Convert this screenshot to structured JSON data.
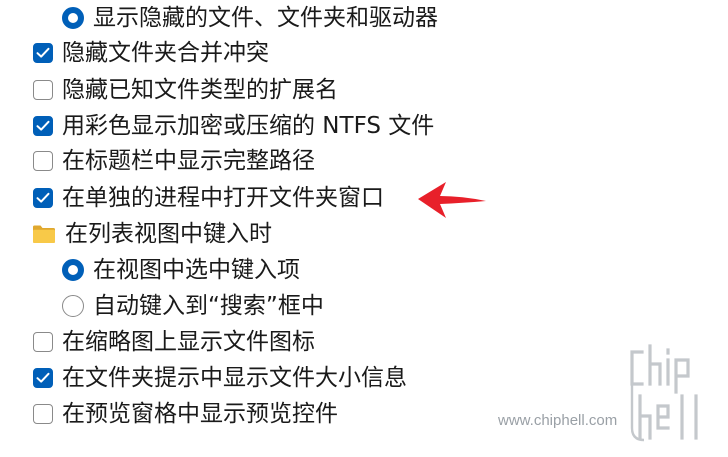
{
  "options": [
    {
      "kind": "radio",
      "checked": true,
      "label": "显示隐藏的文件、文件夹和驱动器"
    },
    {
      "kind": "checkbox",
      "checked": true,
      "label": "隐藏文件夹合并冲突"
    },
    {
      "kind": "checkbox",
      "checked": false,
      "label": "隐藏已知文件类型的扩展名"
    },
    {
      "kind": "checkbox",
      "checked": true,
      "label": "用彩色显示加密或压缩的 NTFS 文件"
    },
    {
      "kind": "checkbox",
      "checked": false,
      "label": "在标题栏中显示完整路径"
    },
    {
      "kind": "checkbox",
      "checked": true,
      "label": "在单独的进程中打开文件夹窗口"
    },
    {
      "kind": "folder",
      "label": "在列表视图中键入时"
    },
    {
      "kind": "radio",
      "checked": true,
      "label": "在视图中选中键入项"
    },
    {
      "kind": "radio",
      "checked": false,
      "label": "自动键入到“搜索”框中"
    },
    {
      "kind": "checkbox",
      "checked": false,
      "label": "在缩略图上显示文件图标"
    },
    {
      "kind": "checkbox",
      "checked": true,
      "label": "在文件夹提示中显示文件大小信息"
    },
    {
      "kind": "checkbox",
      "checked": false,
      "label": "在预览窗格中显示预览控件"
    }
  ],
  "annotation": {
    "icon": "red-arrow-icon",
    "color": "#e8202a"
  },
  "watermark": {
    "logo_text": "chip hell",
    "url": "www.chiphell.com"
  },
  "colors": {
    "accent": "#005fb8",
    "folder": "#f5c242",
    "text": "#1a1a1a"
  }
}
